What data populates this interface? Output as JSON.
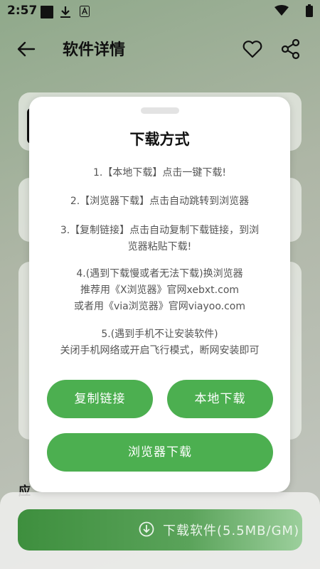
{
  "status_bar": {
    "time": "2:57",
    "icons": [
      "notification-square-icon",
      "download-icon",
      "a-badge-icon",
      "wifi-icon",
      "battery-icon"
    ]
  },
  "header": {
    "title": "软件详情",
    "icons": [
      "back-arrow-icon",
      "heart-icon",
      "share-icon"
    ]
  },
  "background": {
    "section_label": "应",
    "download_button_label": "下载软件(5.5MB/GM)"
  },
  "modal": {
    "title": "下载方式",
    "instructions": [
      [
        "1.【本地下载】点击一键下载!"
      ],
      [
        "2.【浏览器下载】点击自动跳转到浏览器"
      ],
      [
        "3.【复制链接】点击自动复制下载链接，到浏",
        "览器粘贴下载!"
      ],
      [
        "4.(遇到下载慢或者无法下载)换浏览器",
        "推荐用《X浏览器》官网xebxt.com",
        "或者用《via浏览器》官网viayoo.com"
      ],
      [
        "5.(遇到手机不让安装软件)",
        "关闭手机网络或开启飞行模式，断网安装即可"
      ]
    ],
    "buttons": {
      "copy_link": "复制链接",
      "local_download": "本地下载",
      "browser_download": "浏览器下载"
    }
  },
  "colors": {
    "accent": "#4caf50",
    "modal_bg": "#ffffff"
  }
}
